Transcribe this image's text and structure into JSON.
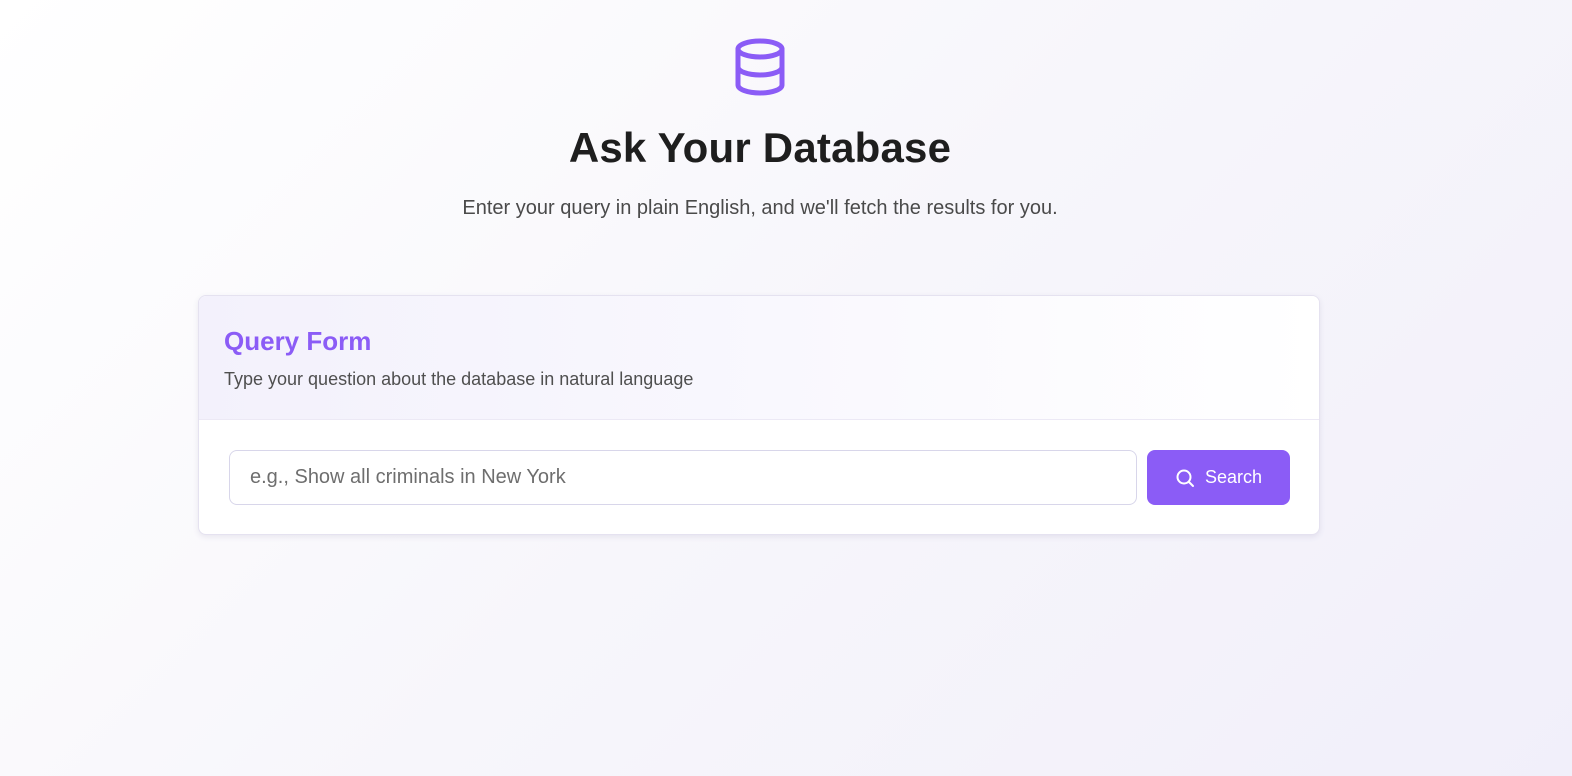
{
  "header": {
    "icon": "database-icon",
    "title": "Ask Your Database",
    "subtitle": "Enter your query in plain English, and we'll fetch the results for you."
  },
  "query_form": {
    "title": "Query Form",
    "description": "Type your question about the database in natural language",
    "input_placeholder": "e.g., Show all criminals in New York",
    "input_value": "",
    "button_label": "Search",
    "button_icon": "search-icon"
  },
  "colors": {
    "accent": "#8b5cf6",
    "title_text": "#1e1e1e",
    "muted_text": "#4a4a4a"
  }
}
